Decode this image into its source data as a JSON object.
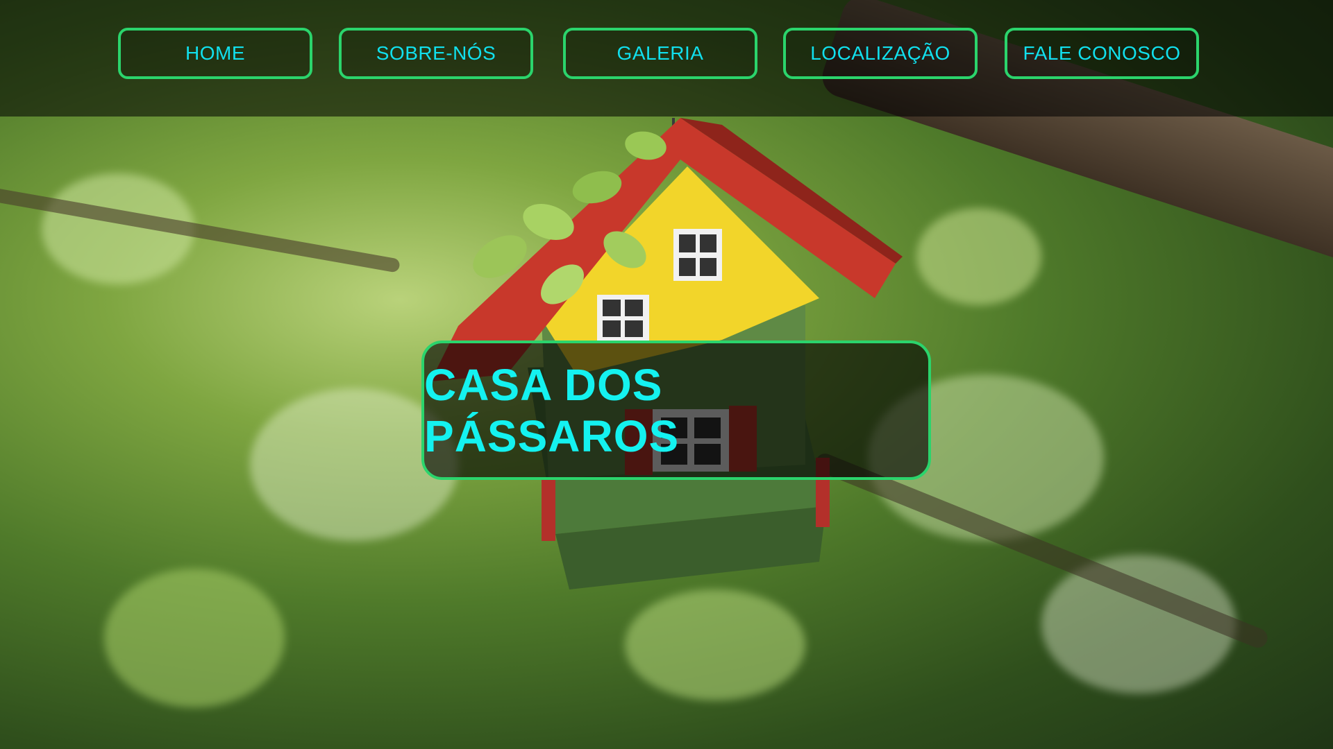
{
  "nav": {
    "items": [
      {
        "label": "HOME"
      },
      {
        "label": "SOBRE-NÓS"
      },
      {
        "label": "GALERIA"
      },
      {
        "label": "LOCALIZAÇÃO"
      },
      {
        "label": "FALE CONOSCO"
      }
    ]
  },
  "hero": {
    "title": "CASA DOS PÁSSAROS"
  },
  "colors": {
    "accent_border": "#2bd46c",
    "text_cyan": "#11e0ee"
  }
}
